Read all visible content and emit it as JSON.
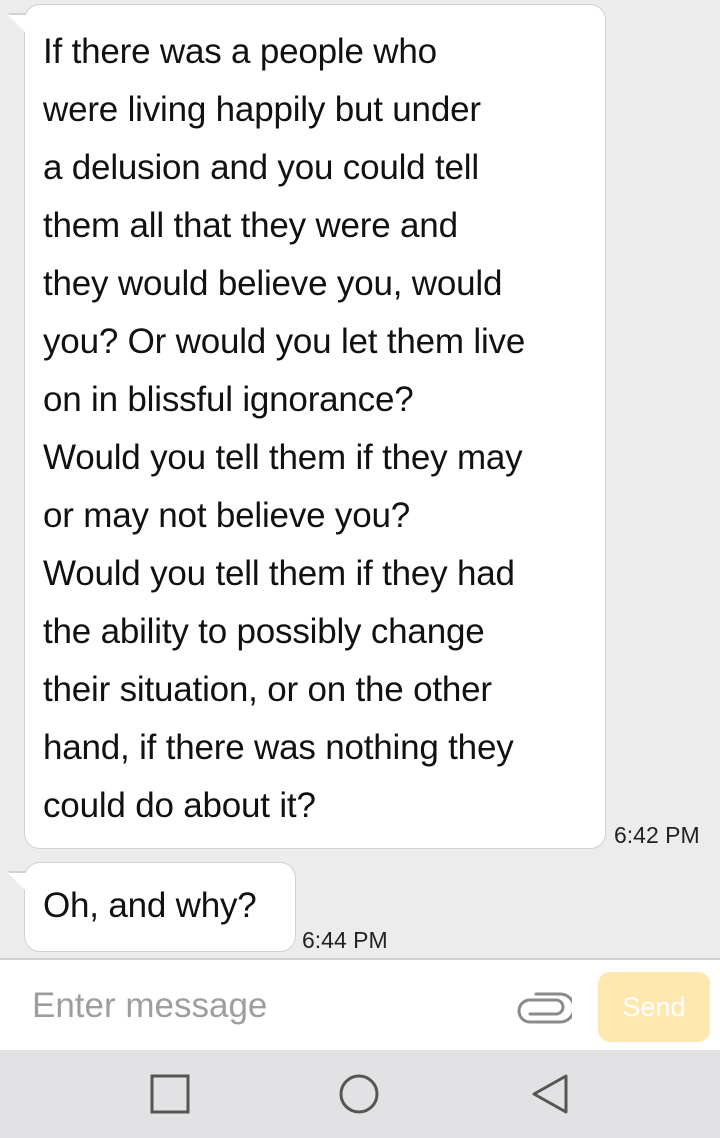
{
  "messages": [
    {
      "text": "If there was a people who\nwere living happily but under\na delusion and you could tell\nthem all that they were and\nthey would believe you, would\nyou? Or would you let them live\non in blissful ignorance?\nWould you tell them if they may\nor may not believe you?\nWould you tell them if they had\nthe ability to possibly change\ntheir situation, or on the other\nhand, if there was nothing they\ncould do about it?",
      "time": "6:42 PM"
    },
    {
      "text": "Oh, and why?",
      "time": "6:44 PM"
    }
  ],
  "input": {
    "placeholder": "Enter message",
    "attach_icon": "paperclip-icon",
    "send_label": "Send"
  },
  "nav": {
    "recents_icon": "square-icon",
    "home_icon": "circle-icon",
    "back_icon": "triangle-back-icon"
  },
  "colors": {
    "background": "#ececec",
    "bubble": "#ffffff",
    "send_button": "#ffe8b0",
    "nav_bar": "#e2e2e4"
  }
}
